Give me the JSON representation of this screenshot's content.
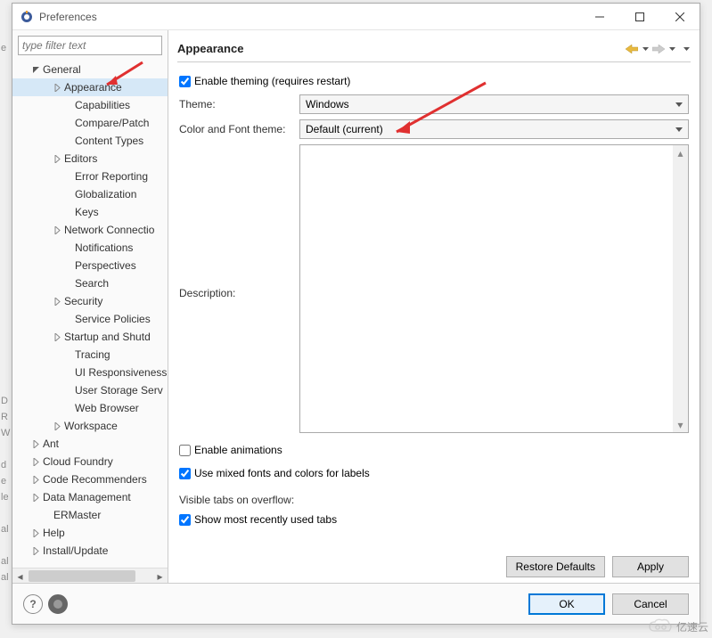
{
  "window": {
    "title": "Preferences"
  },
  "filter": {
    "placeholder": "type filter text"
  },
  "tree": {
    "items": [
      {
        "label": "General",
        "indent": 20,
        "expanded": true,
        "expandable": true,
        "selected": false
      },
      {
        "label": "Appearance",
        "indent": 44,
        "expanded": false,
        "expandable": true,
        "selected": true
      },
      {
        "label": "Capabilities",
        "indent": 56,
        "expandable": false
      },
      {
        "label": "Compare/Patch",
        "indent": 56,
        "expandable": false
      },
      {
        "label": "Content Types",
        "indent": 56,
        "expandable": false
      },
      {
        "label": "Editors",
        "indent": 44,
        "expandable": true
      },
      {
        "label": "Error Reporting",
        "indent": 56,
        "expandable": false
      },
      {
        "label": "Globalization",
        "indent": 56,
        "expandable": false
      },
      {
        "label": "Keys",
        "indent": 56,
        "expandable": false
      },
      {
        "label": "Network Connectio",
        "indent": 44,
        "expandable": true
      },
      {
        "label": "Notifications",
        "indent": 56,
        "expandable": false
      },
      {
        "label": "Perspectives",
        "indent": 56,
        "expandable": false
      },
      {
        "label": "Search",
        "indent": 56,
        "expandable": false
      },
      {
        "label": "Security",
        "indent": 44,
        "expandable": true
      },
      {
        "label": "Service Policies",
        "indent": 56,
        "expandable": false
      },
      {
        "label": "Startup and Shutd",
        "indent": 44,
        "expandable": true
      },
      {
        "label": "Tracing",
        "indent": 56,
        "expandable": false
      },
      {
        "label": "UI Responsiveness",
        "indent": 56,
        "expandable": false
      },
      {
        "label": "User Storage Serv",
        "indent": 56,
        "expandable": false
      },
      {
        "label": "Web Browser",
        "indent": 56,
        "expandable": false
      },
      {
        "label": "Workspace",
        "indent": 44,
        "expandable": true
      },
      {
        "label": "Ant",
        "indent": 20,
        "expandable": true
      },
      {
        "label": "Cloud Foundry",
        "indent": 20,
        "expandable": true
      },
      {
        "label": "Code Recommenders",
        "indent": 20,
        "expandable": true
      },
      {
        "label": "Data Management",
        "indent": 20,
        "expandable": true
      },
      {
        "label": "ERMaster",
        "indent": 32,
        "expandable": false
      },
      {
        "label": "Help",
        "indent": 20,
        "expandable": true
      },
      {
        "label": "Install/Update",
        "indent": 20,
        "expandable": true
      }
    ]
  },
  "panel": {
    "title": "Appearance",
    "enable_theming": "Enable theming (requires restart)",
    "theme_label": "Theme:",
    "theme_value": "Windows",
    "colorfont_label": "Color and Font theme:",
    "colorfont_value": "Default (current)",
    "description_label": "Description:",
    "enable_animations": "Enable animations",
    "mixed_fonts": "Use mixed fonts and colors for labels",
    "visible_tabs_label": "Visible tabs on overflow:",
    "show_recent_tabs": "Show most recently used tabs"
  },
  "buttons": {
    "restore": "Restore Defaults",
    "apply": "Apply",
    "ok": "OK",
    "cancel": "Cancel"
  },
  "watermark": "亿速云",
  "left_strip": [
    "e",
    "",
    "",
    "",
    "",
    "",
    "",
    "",
    "",
    "",
    "",
    "",
    "",
    "",
    "",
    "",
    "",
    "",
    "",
    "",
    "",
    "",
    "D",
    "R",
    "W",
    "",
    "d",
    "e",
    "le",
    "",
    "al",
    "",
    "al",
    "al"
  ]
}
